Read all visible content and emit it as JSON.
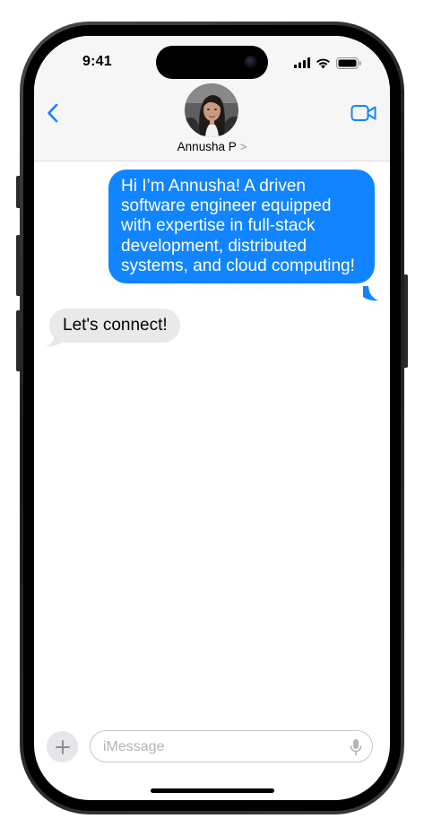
{
  "status_bar": {
    "time": "9:41"
  },
  "header": {
    "contact_name": "Annusha P",
    "chevron": ">",
    "icons": {
      "back": "chevron-left-icon",
      "video": "video-camera-icon"
    }
  },
  "messages": [
    {
      "direction": "outgoing",
      "text": "Hi I’m Annusha! A driven software engineer equipped with expertise in full-stack development, distributed systems, and cloud computing!"
    },
    {
      "direction": "incoming",
      "text": "Let's connect!"
    }
  ],
  "composer": {
    "placeholder": "iMessage",
    "value": ""
  },
  "colors": {
    "accent": "#1185ff",
    "outgoing_bubble": "#1185ff",
    "incoming_bubble": "#e9e9eb",
    "header_background": "#f6f6f7"
  }
}
